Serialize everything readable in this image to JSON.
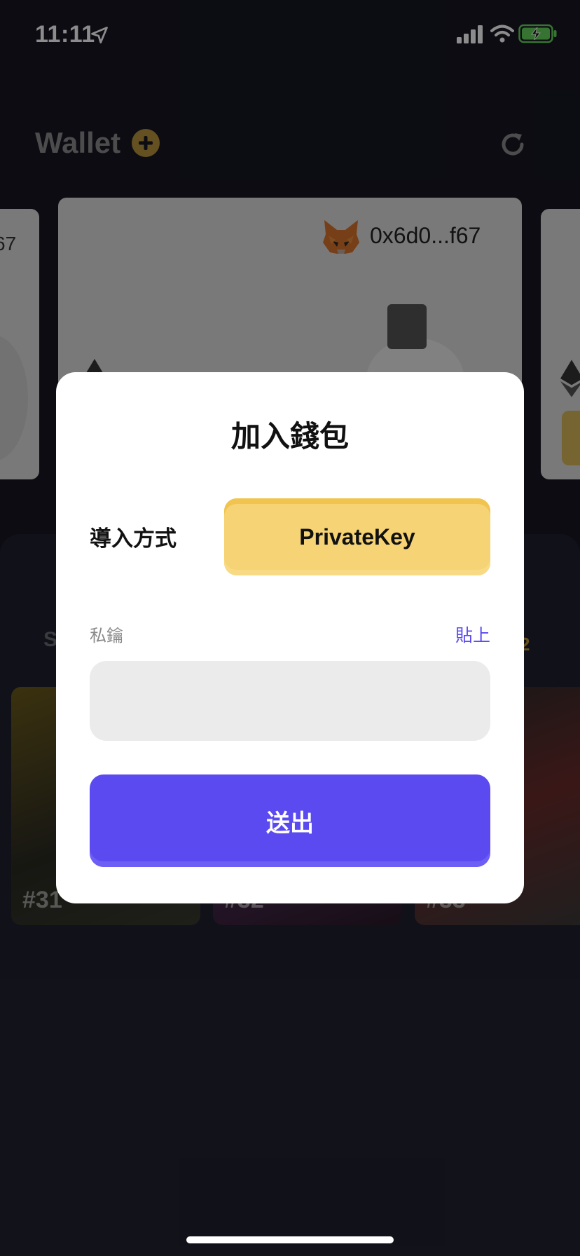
{
  "status_bar": {
    "time": "11:11"
  },
  "header": {
    "title": "Wallet"
  },
  "cards": {
    "left_address_fragment": "67",
    "main_address": "0x6d0...f67"
  },
  "collection": {
    "section_initial": "S",
    "count_fragment": "2",
    "nfts": [
      {
        "label": "#31"
      },
      {
        "label": "#32"
      },
      {
        "label": "#33"
      }
    ]
  },
  "modal": {
    "title": "加入錢包",
    "import_label": "導入方式",
    "import_method": "PrivateKey",
    "key_label": "私鑰",
    "paste_label": "貼上",
    "key_value": "",
    "key_placeholder": "",
    "submit_label": "送出"
  },
  "colors": {
    "accent_purple": "#5a4af0",
    "accent_yellow": "#f6d374",
    "background": "#161722"
  }
}
